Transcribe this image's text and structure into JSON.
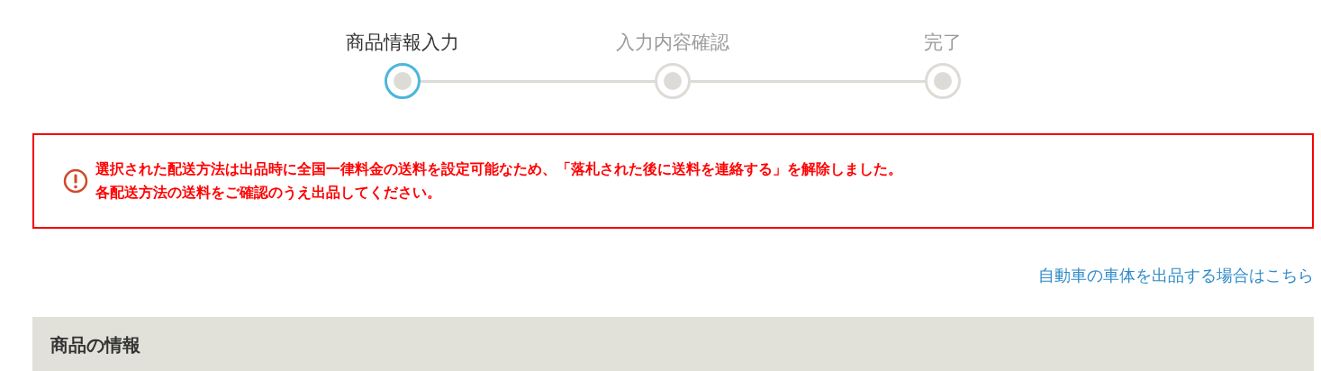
{
  "steps": [
    {
      "label": "商品情報入力",
      "selected": true
    },
    {
      "label": "入力内容確認",
      "selected": false
    },
    {
      "label": "完了",
      "selected": false
    }
  ],
  "alert": {
    "lines": [
      "選択された配送方法は出品時に全国一律料金の送料を設定可能なため、「落札された後に送料を連絡する」を解除しました。",
      "各配送方法の送料をご確認のうえ出品してください。"
    ]
  },
  "car_link": "自動車の車体を出品する場合はこちら",
  "section": {
    "title": "商品の情報"
  }
}
